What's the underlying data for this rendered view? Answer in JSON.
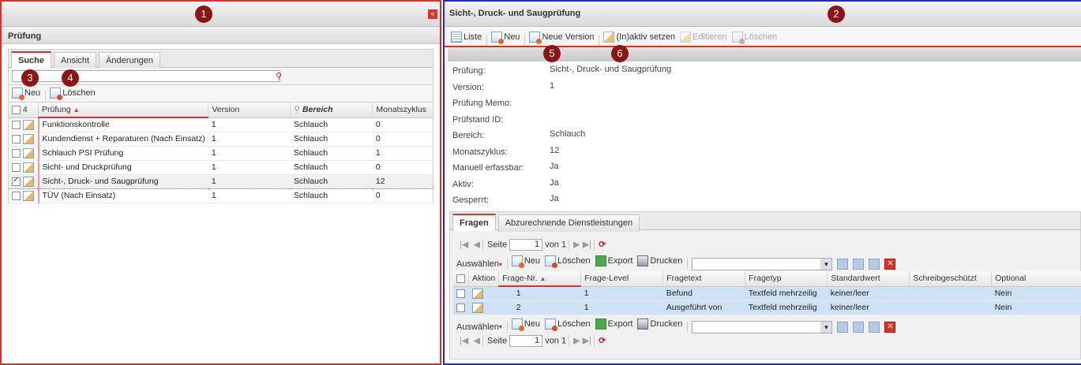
{
  "badges": {
    "b1": "1",
    "b2": "2",
    "b3": "3",
    "b4": "4",
    "b5": "5",
    "b6": "6"
  },
  "left": {
    "title": "Prüfung",
    "tabs": [
      "Suche",
      "Ansicht",
      "Änderungen"
    ],
    "search": {
      "value": "",
      "placeholder": ""
    },
    "toolbar": {
      "new": "Neu",
      "delete": "Löschen"
    },
    "table": {
      "count": "4",
      "headers": [
        "Prüfung",
        "Version",
        "Bereich",
        "Monatszyklus"
      ],
      "rows": [
        {
          "name": "Funktionskontrolle",
          "version": "1",
          "bereich": "Schlauch",
          "zyklus": "0",
          "checked": false
        },
        {
          "name": "Kundendienst + Reparaturen (Nach Einsatz)",
          "version": "1",
          "bereich": "Schlauch",
          "zyklus": "0",
          "checked": false
        },
        {
          "name": "Schlauch PSI Prüfung",
          "version": "1",
          "bereich": "Schlauch",
          "zyklus": "1",
          "checked": false
        },
        {
          "name": "Sicht- und Druckprüfung",
          "version": "1",
          "bereich": "Schlauch",
          "zyklus": "0",
          "checked": false
        },
        {
          "name": "Sicht-, Druck- und Saugprüfung",
          "version": "1",
          "bereich": "Schlauch",
          "zyklus": "12",
          "checked": true
        },
        {
          "name": "TÜV (Nach Einsatz)",
          "version": "1",
          "bereich": "Schlauch",
          "zyklus": "0",
          "checked": false
        }
      ]
    }
  },
  "right": {
    "title": "Sicht-, Druck- und Saugprüfung",
    "toolbar": {
      "liste": "Liste",
      "neu": "Neu",
      "neue_version": "Neue Version",
      "inaktiv": "(In)aktiv setzen",
      "editieren": "Editieren",
      "loeschen": "Löschen"
    },
    "details": [
      {
        "label": "Prüfung:",
        "value": "Sicht-, Druck- und Saugprüfung"
      },
      {
        "label": "Version:",
        "value": "1"
      },
      {
        "label": "Prüfung Memo:",
        "value": ""
      },
      {
        "label": "Prüfstand ID:",
        "value": ""
      },
      {
        "label": "Bereich:",
        "value": "Schlauch"
      },
      {
        "label": "Monatszyklus:",
        "value": "12"
      },
      {
        "label": "Manuell erfassbar:",
        "value": "Ja"
      },
      {
        "label": "Aktiv:",
        "value": "Ja"
      },
      {
        "label": "Gesperrt:",
        "value": "Ja"
      }
    ],
    "tabs": [
      "Fragen",
      "Abzurechnende Dienstleistungen"
    ],
    "pager": {
      "seite": "Seite",
      "page": "1",
      "of": "von 1"
    },
    "actions": {
      "auswaehlen": "Auswählen",
      "neu": "Neu",
      "loeschen": "Löschen",
      "export": "Export",
      "drucken": "Drucken"
    },
    "table": {
      "headers": [
        "Aktion",
        "Frage-Nr.",
        "Frage-Level",
        "Fragetext",
        "Fragetyp",
        "Standardwert",
        "Schreibgeschützt",
        "Optional"
      ],
      "rows": [
        {
          "nr": "1",
          "level": "1",
          "text": "Befund",
          "typ": "Textfeld mehrzeilig",
          "std": "keiner/leer",
          "sg": "",
          "opt": "Nein"
        },
        {
          "nr": "2",
          "level": "1",
          "text": "Ausgeführt von",
          "typ": "Textfeld mehrzeilig",
          "std": "keiner/leer",
          "sg": "",
          "opt": "Nein"
        }
      ]
    }
  }
}
